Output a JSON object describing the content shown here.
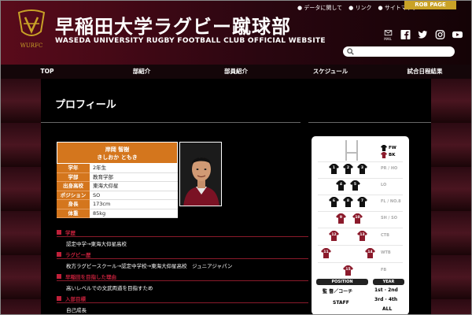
{
  "header": {
    "title_ja": "早稲田大学ラグビー蹴球部",
    "title_en": "WASEDA UNIVERSITY RUGBY FOOTBALL CLUB OFFICIAL WEBSITE",
    "top_links": [
      "データに関して",
      "リンク",
      "サイトマップ"
    ],
    "rob_button": "ROB PAGE",
    "mail_label": "MAIL",
    "search_placeholder": ""
  },
  "nav": [
    "TOP",
    "部紹介",
    "部員紹介",
    "スケジュール",
    "試合日程結果"
  ],
  "page_title": "プロフィール",
  "profile": {
    "name_kanji": "岸岡 智樹",
    "name_kana": "きしおか ともき",
    "fields": [
      {
        "key": "学年",
        "value": "2年生"
      },
      {
        "key": "学部",
        "value": "教育学部"
      },
      {
        "key": "出身高校",
        "value": "東海大仰星"
      },
      {
        "key": "ポジション",
        "value": "SO"
      },
      {
        "key": "身長",
        "value": "173cm"
      },
      {
        "key": "体重",
        "value": "85kg"
      }
    ]
  },
  "sections": [
    {
      "title": "学歴",
      "body": "認定中学→東海大仰星高校"
    },
    {
      "title": "ラグビー歴",
      "body": "枚方ラグビースクール→認定中学校→東海大仰星高校　ジュニアジャパン"
    },
    {
      "title": "早稲田を目指した理由",
      "body": "高いレベルでの文武両道を目指すため"
    },
    {
      "title": "入部目標",
      "body": "自己成長"
    }
  ],
  "formation": {
    "legend_fw": "FW",
    "legend_bk": "BK",
    "rows": [
      {
        "label": "PR / HO",
        "numbers": [
          "1",
          "2",
          "3"
        ],
        "type": "fw"
      },
      {
        "label": "LO",
        "numbers": [
          "4",
          "5"
        ],
        "type": "fw"
      },
      {
        "label": "FL / NO.8",
        "numbers": [
          "6",
          "8",
          "7"
        ],
        "type": "fw"
      },
      {
        "label": "SH / SO",
        "numbers": [
          "9",
          "10"
        ],
        "type": "bk"
      },
      {
        "label": "CTB",
        "numbers": [
          "12",
          "13"
        ],
        "type": "bk"
      },
      {
        "label": "WTB",
        "numbers": [
          "11",
          "14"
        ],
        "type": "bk"
      },
      {
        "label": "FB",
        "numbers": [
          "15"
        ],
        "type": "bk"
      }
    ],
    "position_head": "POSITION",
    "year_head": "YEAR",
    "position_opts": [
      "監 督／コーチ",
      "STAFF"
    ],
    "year_opts": [
      "1st · 2nd",
      "3rd · 4th",
      "ALL"
    ]
  },
  "colors": {
    "accent_orange": "#d4761d",
    "crimson": "#8b1a2b",
    "gold": "#c9a227"
  }
}
